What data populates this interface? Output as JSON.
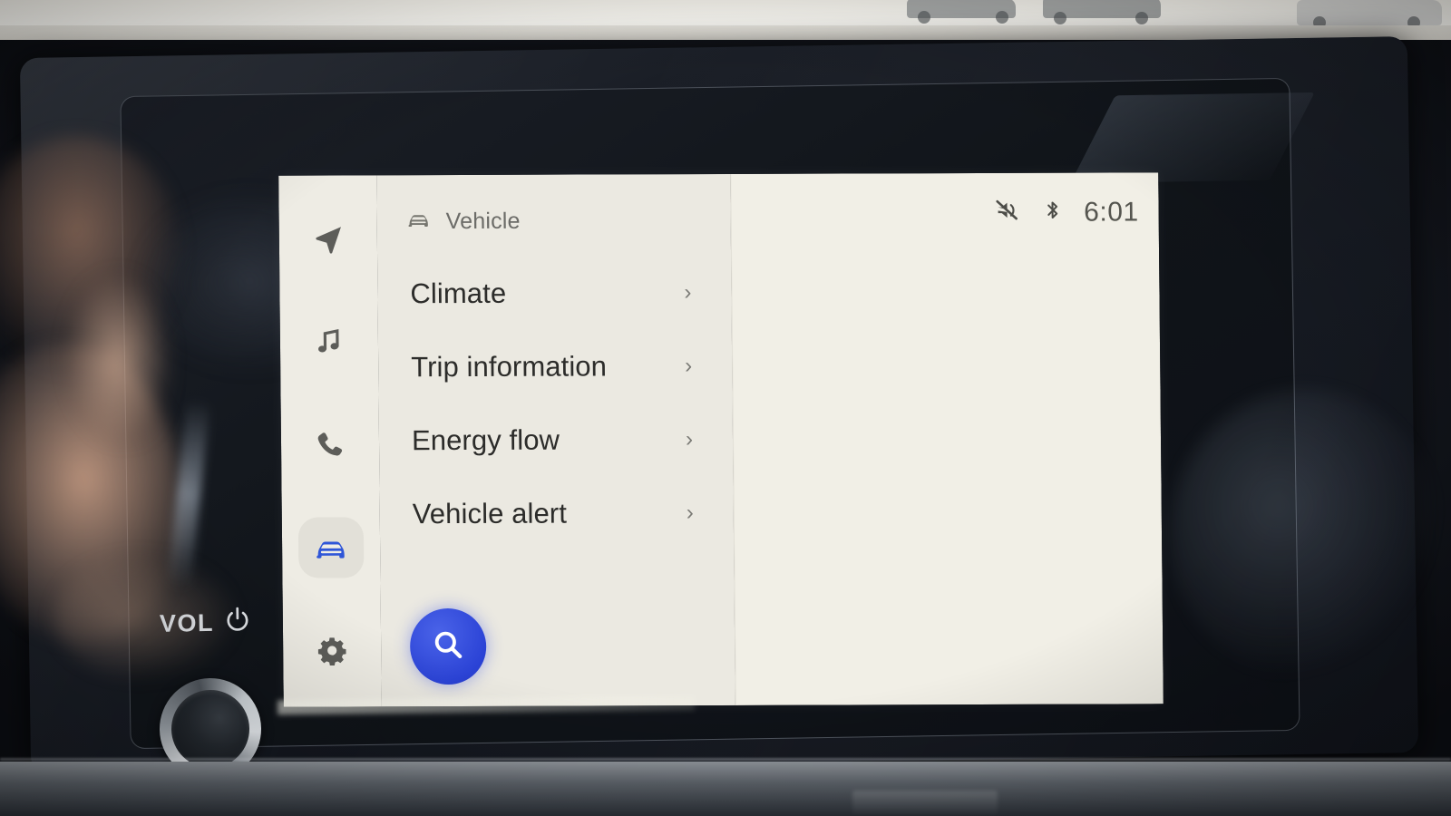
{
  "screen": {
    "panel_title": "Vehicle",
    "panel_title_icon": "car-icon",
    "menu_items": [
      {
        "label": "Climate",
        "chevron": "›",
        "icon": "chevron-right-icon"
      },
      {
        "label": "Trip information",
        "chevron": "›",
        "icon": "chevron-right-icon"
      },
      {
        "label": "Energy flow",
        "chevron": "›",
        "icon": "chevron-right-icon"
      },
      {
        "label": "Vehicle alert",
        "chevron": "›",
        "icon": "chevron-right-icon"
      }
    ],
    "rail": [
      {
        "name": "navigation-icon",
        "label": "Navigation",
        "active": false
      },
      {
        "name": "media-icon",
        "label": "Media",
        "active": false
      },
      {
        "name": "phone-icon",
        "label": "Phone",
        "active": false
      },
      {
        "name": "car-icon",
        "label": "Vehicle",
        "active": true
      },
      {
        "name": "gear-icon",
        "label": "Settings",
        "active": false
      }
    ],
    "search_button": {
      "icon": "search-icon",
      "label": "Search"
    },
    "statusbar": {
      "mute_icon": "volume-muted-icon",
      "bluetooth_icon": "bluetooth-icon",
      "clock": "6:01"
    }
  },
  "hardware": {
    "volume_label": "VOL",
    "power_icon": "power-icon",
    "knob": "volume-knob"
  },
  "colors": {
    "accent_blue": "#2b43d6",
    "panel_left": "#ebe9e1",
    "panel_right": "#f1efe6",
    "rail": "#eeece4",
    "text_primary": "#2c2c2a",
    "text_secondary": "#6c6c68",
    "icon_gray": "#5d5d59",
    "active_icon_blue": "#2f56d8"
  }
}
